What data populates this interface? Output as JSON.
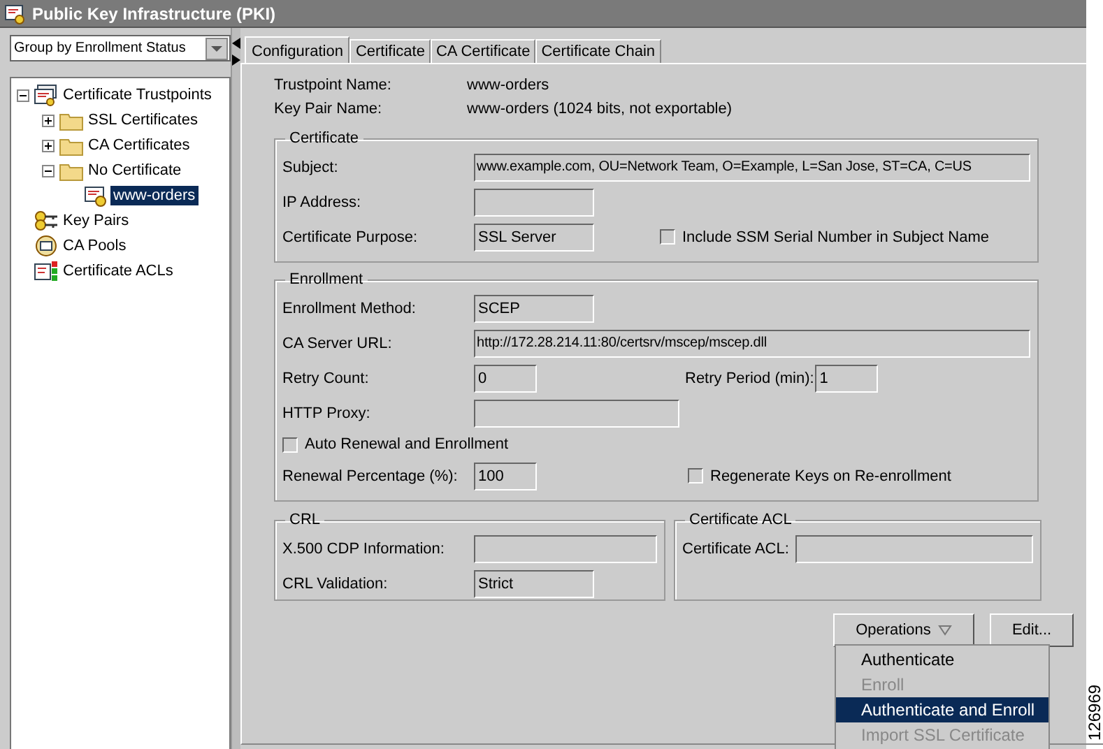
{
  "window": {
    "title": "Public Key Infrastructure (PKI)"
  },
  "group_by": {
    "value": "Group by Enrollment Status"
  },
  "tree": [
    {
      "label": "Certificate Trustpoints",
      "kind": "trustpoints",
      "expanded": true,
      "selected": false,
      "children": [
        {
          "label": "SSL Certificates",
          "kind": "folder",
          "expanded": false,
          "selected": false
        },
        {
          "label": "CA Certificates",
          "kind": "folder",
          "expanded": false,
          "selected": false
        },
        {
          "label": "No Certificate",
          "kind": "folder",
          "expanded": true,
          "selected": false,
          "children": [
            {
              "label": "www-orders",
              "kind": "certificate",
              "selected": true
            }
          ]
        }
      ]
    },
    {
      "label": "Key Pairs",
      "kind": "key_pairs",
      "selected": false
    },
    {
      "label": "CA Pools",
      "kind": "ca_pools",
      "selected": false
    },
    {
      "label": "Certificate ACLs",
      "kind": "acls",
      "selected": false
    }
  ],
  "tabs": [
    {
      "label": "Configuration",
      "selected": true
    },
    {
      "label": "Certificate",
      "selected": false
    },
    {
      "label": "CA Certificate",
      "selected": false
    },
    {
      "label": "Certificate Chain",
      "selected": false
    }
  ],
  "trustpoint_name": {
    "label": "Trustpoint Name:",
    "value": "www-orders"
  },
  "key_pair_name": {
    "label": "Key Pair Name:",
    "value": "www-orders (1024 bits, not exportable)"
  },
  "certificate": {
    "title": "Certificate",
    "subject": {
      "label": "Subject:",
      "value": "www.example.com, OU=Network Team, O=Example, L=San Jose, ST=CA, C=US"
    },
    "ip_address": {
      "label": "IP Address:"
    },
    "purpose": {
      "label": "Certificate Purpose:",
      "value": "SSL Server"
    },
    "include_serial": {
      "label": "Include SSM Serial Number in Subject Name",
      "checked": false
    }
  },
  "enrollment": {
    "title": "Enrollment",
    "method": {
      "label": "Enrollment Method:",
      "value": "SCEP"
    },
    "ca_server_url": {
      "label": "CA Server URL:",
      "value": "http://172.28.214.11:80/certsrv/mscep/mscep.dll"
    },
    "retry_count": {
      "label": "Retry Count:",
      "value": "0"
    },
    "retry_period": {
      "label": "Retry Period (min):",
      "value": "1"
    },
    "http_proxy": {
      "label": "HTTP Proxy:"
    },
    "auto_renewal": {
      "label": "Auto Renewal and Enrollment",
      "checked": false
    },
    "renewal_percentage": {
      "label": "Renewal Percentage (%):",
      "value": "100"
    },
    "regenerate_keys": {
      "label": "Regenerate Keys on Re-enrollment",
      "checked": false
    }
  },
  "crl": {
    "title": "CRL",
    "cdp": {
      "label": "X.500 CDP Information:"
    },
    "validation": {
      "label": "CRL Validation:",
      "value": "Strict"
    }
  },
  "certificate_acl": {
    "title": "Certificate ACL",
    "acl": {
      "label": "Certificate ACL:"
    }
  },
  "buttons": {
    "operations": "Operations",
    "edit": "Edit..."
  },
  "operations_menu": [
    {
      "label": "Authenticate",
      "disabled": false,
      "selected": false
    },
    {
      "label": "Enroll",
      "disabled": true,
      "selected": false
    },
    {
      "label": "Authenticate and Enroll",
      "disabled": false,
      "selected": true
    },
    {
      "label": "Import SSL Certificate",
      "disabled": true,
      "selected": false
    }
  ],
  "figure_number": "126969"
}
